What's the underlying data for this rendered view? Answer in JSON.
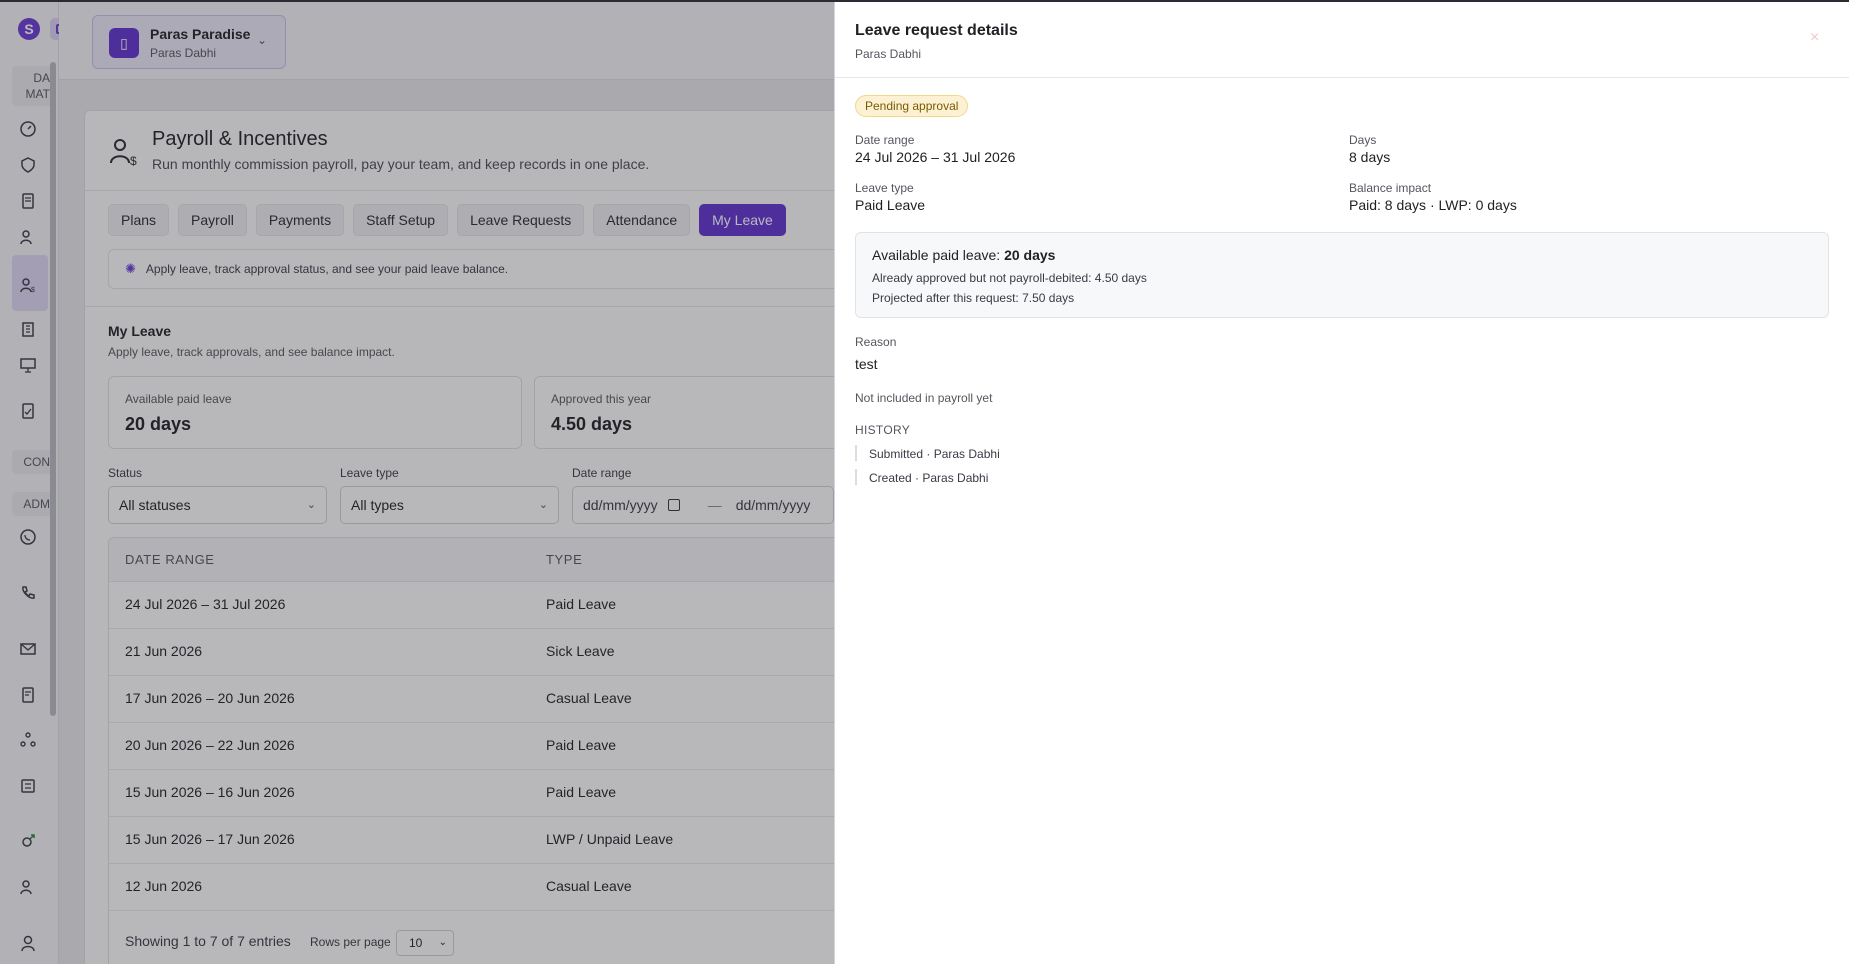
{
  "rail": {
    "logo_letter": "S",
    "section1": "DA MAT",
    "section2": "CON",
    "section3": "ADM",
    "icons": [
      "dashboard-icon",
      "shield-icon",
      "receipt-icon",
      "user-dollar-icon",
      "payroll-user-icon",
      "building-icon",
      "presentation-icon",
      "checklist-icon",
      "whatsapp-icon",
      "phone-call-icon",
      "mail-icon",
      "invoice-icon",
      "network-icon",
      "calculator-icon",
      "gender-icon",
      "user-question-icon",
      "profile-icon"
    ]
  },
  "org": {
    "name": "Paras Paradise",
    "user": "Paras Dabhi"
  },
  "page": {
    "title": "Payroll & Incentives",
    "subtitle": "Run monthly commission payroll, pay your team, and keep records in one place.",
    "tabs": [
      {
        "label": "Plans"
      },
      {
        "label": "Payroll"
      },
      {
        "label": "Payments"
      },
      {
        "label": "Staff Setup"
      },
      {
        "label": "Leave Requests"
      },
      {
        "label": "Attendance"
      },
      {
        "label": "My Leave",
        "active": true
      }
    ],
    "tip": "Apply leave, track approval status, and see your paid leave balance."
  },
  "my_leave": {
    "title": "My Leave",
    "subtitle": "Apply leave, track approvals, and see balance impact.",
    "stats": [
      {
        "label": "Available paid leave",
        "value": "20 days"
      },
      {
        "label": "Approved this year",
        "value": "4.50 days"
      }
    ],
    "filters": {
      "status_label": "Status",
      "status_value": "All statuses",
      "type_label": "Leave type",
      "type_value": "All types",
      "date_label": "Date range",
      "date_from": "dd/mm/yyyy",
      "date_sep": "—",
      "date_to": "dd/mm/yyyy"
    },
    "table": {
      "headers": [
        "DATE RANGE",
        "TYPE"
      ],
      "rows": [
        {
          "date": "24 Jul 2026 – 31 Jul 2026",
          "type": "Paid Leave"
        },
        {
          "date": "21 Jun 2026",
          "type": "Sick Leave"
        },
        {
          "date": "17 Jun 2026 – 20 Jun 2026",
          "type": "Casual Leave"
        },
        {
          "date": "20 Jun 2026 – 22 Jun 2026",
          "type": "Paid Leave"
        },
        {
          "date": "15 Jun 2026 – 16 Jun 2026",
          "type": "Paid Leave"
        },
        {
          "date": "15 Jun 2026 – 17 Jun 2026",
          "type": "LWP / Unpaid Leave"
        },
        {
          "date": "12 Jun 2026",
          "type": "Casual Leave"
        }
      ]
    },
    "footer": {
      "showing": "Showing 1 to 7 of 7 entries",
      "rows_label": "Rows per page",
      "rows_value": "10"
    }
  },
  "drawer": {
    "title": "Leave request details",
    "subtitle": "Paras Dabhi",
    "close": "×",
    "badge": "Pending approval",
    "date_range_label": "Date range",
    "date_range_value": "24 Jul 2026 – 31 Jul 2026",
    "days_label": "Days",
    "days_value": "8 days",
    "leave_type_label": "Leave type",
    "leave_type_value": "Paid Leave",
    "balance_label": "Balance impact",
    "balance_value": "Paid: 8 days · LWP: 0 days",
    "available_prefix": "Available paid leave:",
    "available_value": "20 days",
    "already_approved": "Already approved but not payroll-debited: 4.50 days",
    "projected": "Projected after this request: 7.50 days",
    "reason_label": "Reason",
    "reason_value": "test",
    "payroll_note": "Not included in payroll yet",
    "history_label": "HISTORY",
    "history": [
      "Submitted · Paras Dabhi",
      "Created · Paras Dabhi"
    ]
  },
  "colors": {
    "accent": "#5f32cf",
    "badge_bg": "#fdf1d3",
    "badge_text": "#7a5a00"
  }
}
